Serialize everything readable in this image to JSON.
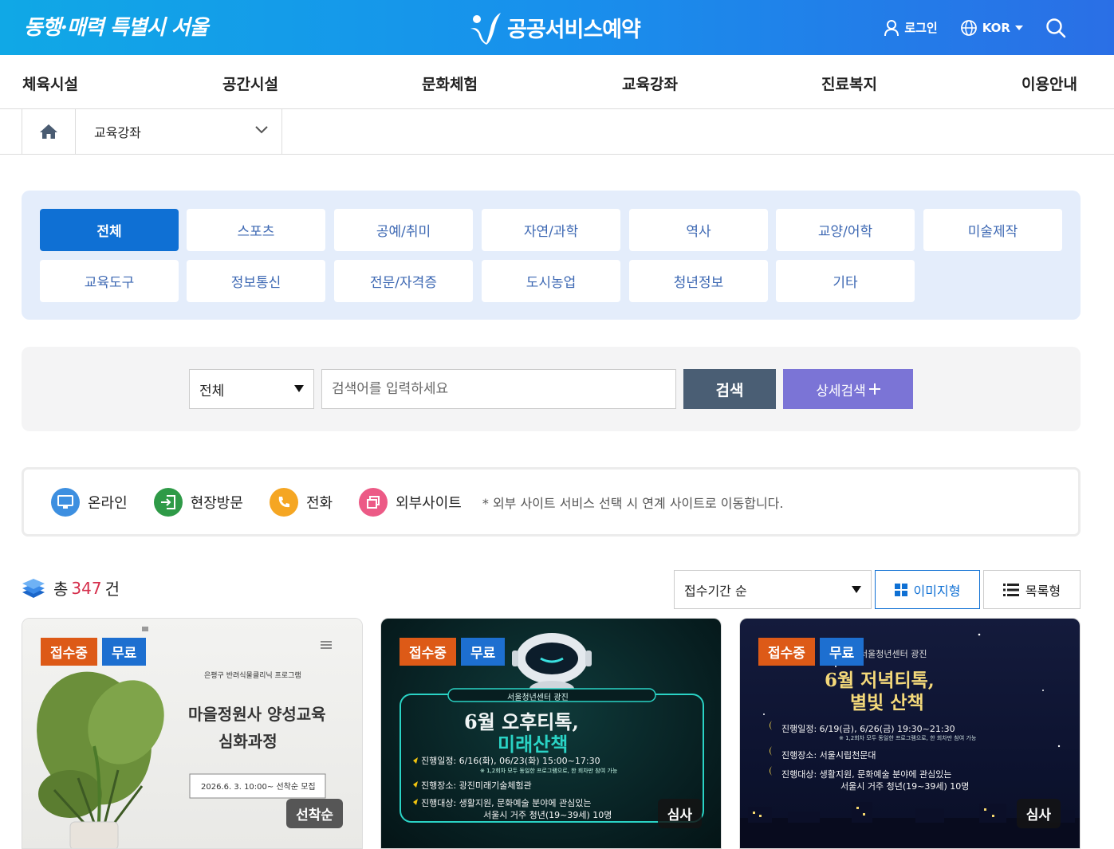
{
  "header": {
    "slogan": "동행·매력 특별시 서울",
    "service_title": "공공서비스예약",
    "login_label": "로그인",
    "language_label": "KOR"
  },
  "gnb": {
    "items": [
      "체육시설",
      "공간시설",
      "문화체험",
      "교육강좌",
      "진료복지",
      "이용안내"
    ]
  },
  "breadcrumb": {
    "current": "교육강좌"
  },
  "categories": {
    "items": [
      "전체",
      "스포츠",
      "공예/취미",
      "자연/과학",
      "역사",
      "교양/어학",
      "미술제작",
      "교육도구",
      "정보통신",
      "전문/자격증",
      "도시농업",
      "청년정보",
      "기타"
    ],
    "active": "전체"
  },
  "search": {
    "scope_value": "전체",
    "placeholder": "검색어를 입력하세요",
    "search_label": "검색",
    "advanced_label": "상세검색"
  },
  "legend": {
    "items": [
      {
        "label": "온라인",
        "color": "#3d8fe0"
      },
      {
        "label": "현장방문",
        "color": "#2e9a47"
      },
      {
        "label": "전화",
        "color": "#f5a623"
      },
      {
        "label": "외부사이트",
        "color": "#ec5a86"
      }
    ],
    "note": "* 외부 사이트 서비스 선택 시 연계 사이트로 이동합니다."
  },
  "results": {
    "total_prefix": "총",
    "total_count": "347",
    "total_suffix": "건",
    "sort_value": "접수기간 순",
    "view_image_label": "이미지형",
    "view_list_label": "목록형"
  },
  "cards": [
    {
      "status": "접수중",
      "fee": "무료",
      "mode": "선착순",
      "poster_org": "은평구 반려식물클리닉 프로그램",
      "poster_title1": "마을정원사 양성교육",
      "poster_title2": "심화과정",
      "poster_date": "2026.6. 3. 10:00~ 선착순 모집"
    },
    {
      "status": "접수중",
      "fee": "무료",
      "mode": "심사",
      "poster_org": "서울청년센터 광진",
      "poster_title1": "6월 오후티톡,",
      "poster_title2": "미래산책",
      "poster_line1": "진행일정: 6/16(화), 06/23(화) 15:00~17:30",
      "poster_line1_note": "※ 1,2회차 모두 동일한 프로그램으로, 한 회차만 참여 가능",
      "poster_line2": "진행장소: 광진미래기술체험관",
      "poster_line3": "진행대상: 생활지원, 문화예술 분야에 관심있는",
      "poster_line4": "서울시 거주 청년(19~39세) 10명"
    },
    {
      "status": "접수중",
      "fee": "무료",
      "mode": "심사",
      "poster_org": "서울청년센터 광진",
      "poster_title1": "6월 저녁티톡,",
      "poster_title2": "별빛 산책",
      "poster_line1": "진행일정: 6/19(금), 6/26(금) 19:30~21:30",
      "poster_line1_note": "※ 1,2회차 모두 동일한 프로그램으로, 한 회차만 참여 가능",
      "poster_line2": "진행장소: 서울시립천문대",
      "poster_line3": "진행대상: 생활지원, 문화예술 분야에 관심있는",
      "poster_line4": "서울시 거주 청년(19~39세) 10명"
    }
  ]
}
